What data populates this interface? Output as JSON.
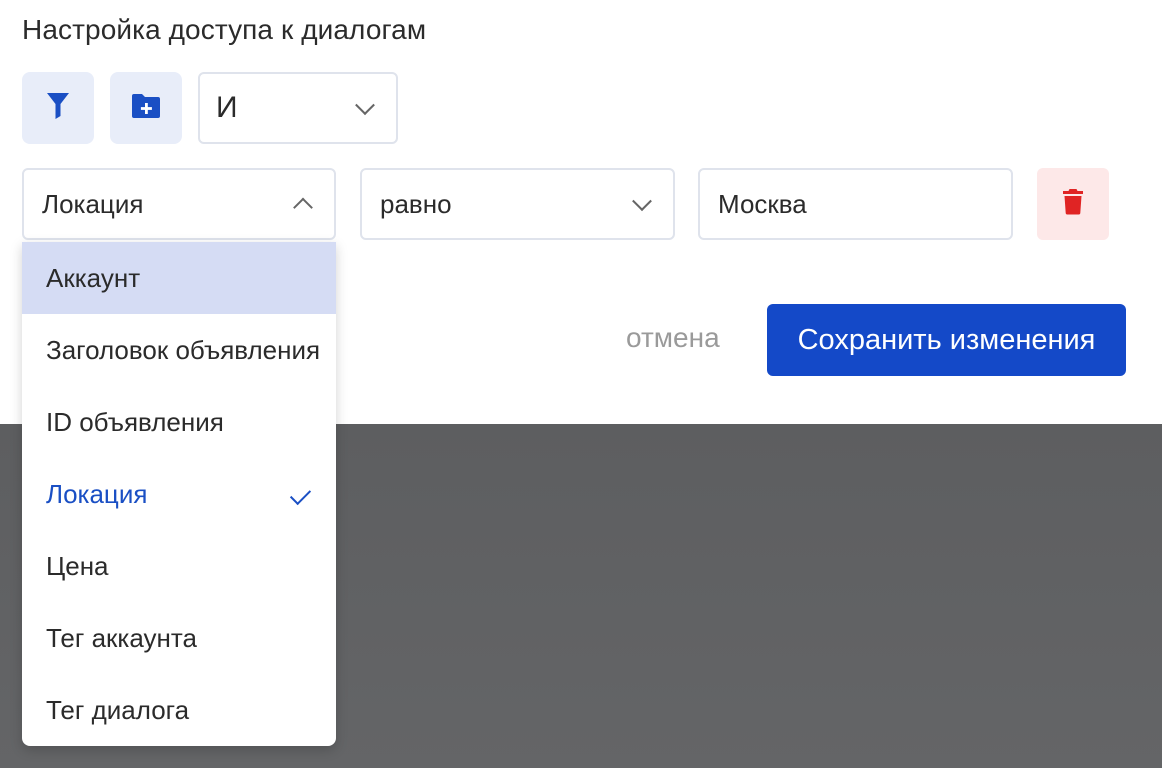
{
  "page": {
    "title": "Настройка доступа к диалогам"
  },
  "toolbar": {
    "filter_icon": "filter-icon",
    "folder_icon": "folder-plus-icon",
    "logic_value": "И"
  },
  "rule": {
    "field_value": "Локация",
    "operator_value": "равно",
    "value": "Москва",
    "delete_icon": "trash-icon"
  },
  "actions": {
    "cancel_label": "отмена",
    "save_label": "Сохранить изменения"
  },
  "dropdown": {
    "options": [
      {
        "label": "Аккаунт",
        "state": "hover"
      },
      {
        "label": "Заголовок объявления",
        "state": ""
      },
      {
        "label": "ID объявления",
        "state": ""
      },
      {
        "label": "Локация",
        "state": "selected"
      },
      {
        "label": "Цена",
        "state": ""
      },
      {
        "label": "Тег аккаунта",
        "state": ""
      },
      {
        "label": "Тег диалога",
        "state": ""
      }
    ]
  },
  "colors": {
    "accent": "#1449c8",
    "icon_blue": "#1a4fc4",
    "danger": "#e02424",
    "danger_bg": "#fde8e8",
    "icon_btn_bg": "#e8edf9",
    "hover_bg": "#d5dcf4"
  }
}
